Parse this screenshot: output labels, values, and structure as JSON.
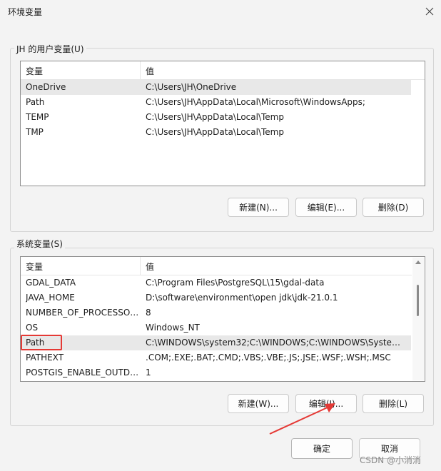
{
  "window": {
    "title": "环境变量"
  },
  "user_vars": {
    "label": "JH 的用户变量(U)",
    "columns": [
      "变量",
      "值"
    ],
    "rows": [
      {
        "name": "OneDrive",
        "value": "C:\\Users\\JH\\OneDrive"
      },
      {
        "name": "Path",
        "value": "C:\\Users\\JH\\AppData\\Local\\Microsoft\\WindowsApps;"
      },
      {
        "name": "TEMP",
        "value": "C:\\Users\\JH\\AppData\\Local\\Temp"
      },
      {
        "name": "TMP",
        "value": "C:\\Users\\JH\\AppData\\Local\\Temp"
      }
    ],
    "buttons": {
      "new": "新建(N)...",
      "edit": "编辑(E)...",
      "delete": "删除(D)"
    }
  },
  "system_vars": {
    "label": "系统变量(S)",
    "columns": [
      "变量",
      "值"
    ],
    "rows": [
      {
        "name": "GDAL_DATA",
        "value": "C:\\Program Files\\PostgreSQL\\15\\gdal-data"
      },
      {
        "name": "JAVA_HOME",
        "value": "D:\\software\\environment\\open jdk\\jdk-21.0.1"
      },
      {
        "name": "NUMBER_OF_PROCESSORS",
        "value": "8"
      },
      {
        "name": "OS",
        "value": "Windows_NT"
      },
      {
        "name": "Path",
        "value": "C:\\WINDOWS\\system32;C:\\WINDOWS;C:\\WINDOWS\\System..."
      },
      {
        "name": "PATHEXT",
        "value": ".COM;.EXE;.BAT;.CMD;.VBS;.VBE;.JS;.JSE;.WSF;.WSH;.MSC"
      },
      {
        "name": "POSTGIS_ENABLE_OUTDB...",
        "value": "1"
      }
    ],
    "buttons": {
      "new": "新建(W)...",
      "edit": "编辑(I)...",
      "delete": "删除(L)"
    }
  },
  "footer": {
    "ok": "确定",
    "cancel": "取消"
  },
  "watermark": "CSDN @小消消",
  "colors": {
    "annotation": "#e53935"
  }
}
